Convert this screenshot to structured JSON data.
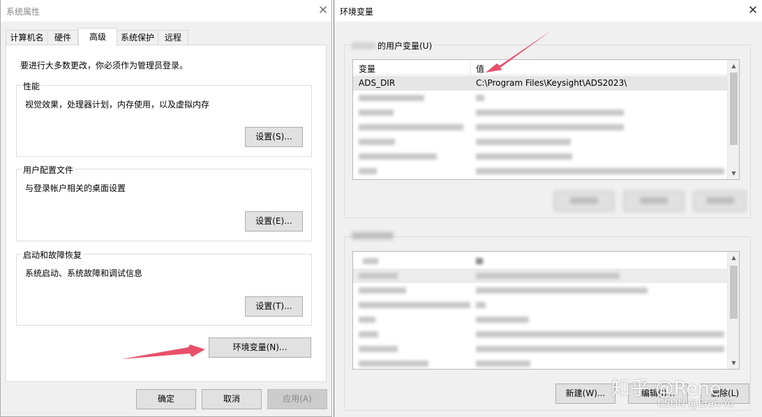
{
  "system_properties": {
    "title": "系统属性",
    "tabs": [
      "计算机名",
      "硬件",
      "高级",
      "系统保护",
      "远程"
    ],
    "notice": "要进行大多数更改，你必须作为管理员登录。",
    "groups": [
      {
        "title": "性能",
        "description": "视觉效果，处理器计划，内存使用，以及虚拟内存",
        "button": "设置(S)..."
      },
      {
        "title": "用户配置文件",
        "description": "与登录帐户相关的桌面设置",
        "button": "设置(E)..."
      },
      {
        "title": "启动和故障恢复",
        "description": "系统启动、系统故障和调试信息",
        "button": "设置(T)..."
      }
    ],
    "env_button": "环境变量(N)...",
    "footer": {
      "ok": "确定",
      "cancel": "取消",
      "apply": "应用(A)"
    }
  },
  "environment_variables": {
    "title": "环境变量",
    "user_section_label": "的用户变量(U)",
    "columns": {
      "name": "变量",
      "value": "值"
    },
    "first_row": {
      "name": "ADS_DIR",
      "value": "C:\\Program Files\\Keysight\\ADS2023\\"
    },
    "system_buttons": {
      "new": "新建(W)...",
      "edit": "编辑(I)...",
      "delete": "删除(L)"
    }
  },
  "watermarks": {
    "zhihu": "知乎 @Rene",
    "csdn": "CSDN @Eren-Yu"
  },
  "colors": {
    "arrow": "#e8506a",
    "dialog_bg": "#f0f0f0",
    "button_bg": "#e1e1e1"
  },
  "icons": [
    "close-icon",
    "scroll-up-icon",
    "scroll-down-icon",
    "arrow-annotation-icon"
  ]
}
